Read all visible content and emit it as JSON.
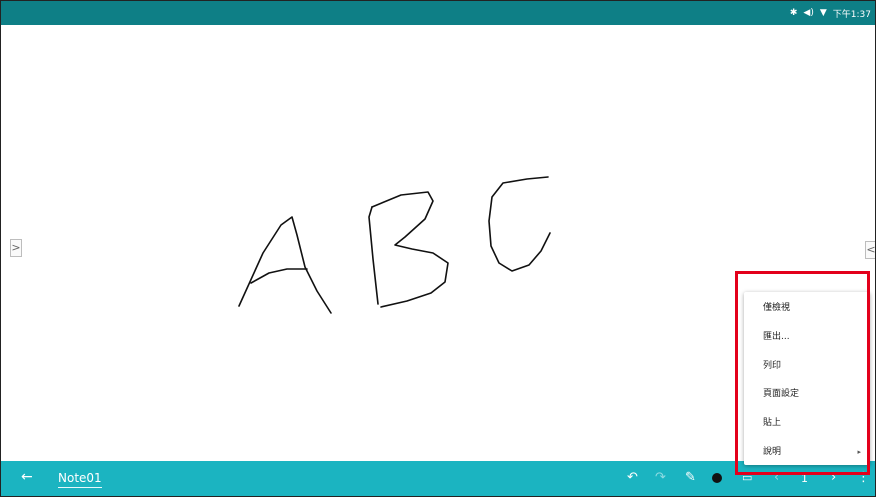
{
  "status_bar": {
    "icons": [
      "bluetooth-icon",
      "volume-icon",
      "wifi-icon"
    ],
    "time": "下午1:37"
  },
  "edge_tabs": {
    "left": ">",
    "right": "<"
  },
  "toolbar": {
    "back_icon": "←",
    "note_title": "Note01",
    "undo_icon": "↶",
    "redo_icon": "↷",
    "pen_icon": "✎",
    "insert_icon": "▭",
    "prev_icon": "‹",
    "page_number": "1",
    "next_icon": "›",
    "more_icon": "⋮"
  },
  "menu": {
    "items": [
      {
        "label": "僅檢視"
      },
      {
        "label": "匯出..."
      },
      {
        "label": "列印"
      },
      {
        "label": "頁面設定"
      },
      {
        "label": "貼上"
      },
      {
        "label": "說明",
        "submenu": "▸"
      }
    ]
  },
  "colors": {
    "status_bar": "#0e7f86",
    "toolbar": "#1bb4c1",
    "highlight": "#e3001b",
    "ink": "#111111"
  }
}
